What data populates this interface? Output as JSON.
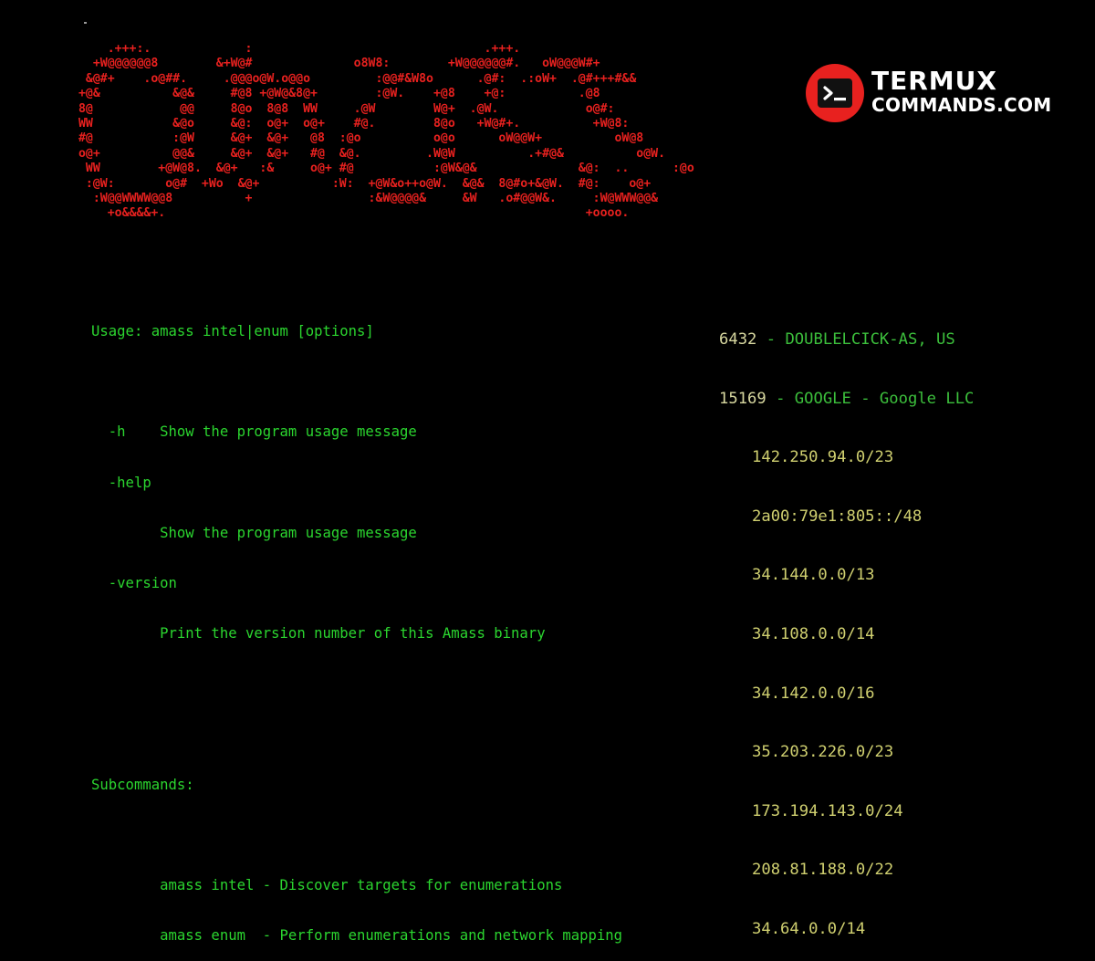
{
  "banner": {
    "ascii_art": "     .+++:.             :                                .+++.\n   +W@@@@@@8        &+W@#              o8W8:        +W@@@@@@#.   oW@@@W#+\n  &@#+    .o@##.     .@@@o@W.o@@o         :@@#&W8o      .@#:  .:oW+  .@#+++#&&\n +@&          &@&     #@8 +@W@&8@+        :@W.    +@8    +@:          .@8\n 8@            @@     8@o  8@8  WW     .@W        W@+  .@W.            o@#:\n WW           &@o     &@:  o@+  o@+    #@.        8@o   +W@#+.          +W@8:\n #@           :@W     &@+  &@+   @8  :@o          o@o      oW@@W+          oW@8\n o@+          @@&     &@+  &@+   #@  &@.         .W@W          .+#@&          o@W.\n  WW        +@W@8.  &@+   :&     o@+ #@           :@W&@&              &@:  ..      :@o\n  :@W:       o@#  +Wo  &@+          :W:  +@W&o++o@W.  &@&  8@#o+&@W.  #@:    o@+\n   :W@@WWWW@@8          +                :&W@@@@&     &W   .o#@@W&.     :W@WWW@@&\n     +o&&&&+.                                                          +oooo."
  },
  "brand": {
    "line1": "TERMUX",
    "line2": "COMMANDS.COM",
    "badge_glyph": "terminal-prompt-icon",
    "accent_color": "#e8211f"
  },
  "help": {
    "usage": "Usage: amass intel|enum [options]",
    "blank1": "",
    "opt_h": "  -h    Show the program usage message",
    "opt_help": "  -help",
    "opt_help_desc": "        Show the program usage message",
    "opt_version": "  -version",
    "opt_version_desc": "        Print the version number of this Amass binary",
    "blank2": "",
    "blank3": "",
    "subcommands": "Subcommands:",
    "blank4": "",
    "cmd_intel": "        amass intel - Discover targets for enumerations",
    "cmd_enum": "        amass enum  - Perform enumerations and network mapping",
    "text_color": "#2bd52f"
  },
  "asn": {
    "entries": [
      {
        "number": "6432",
        "name": " - DOUBLELCICK-AS, US"
      },
      {
        "number": "15169",
        "name": " - GOOGLE - Google LLC"
      }
    ],
    "cidrs": [
      "142.250.94.0/23",
      "2a00:79e1:805::/48",
      "34.144.0.0/13",
      "34.108.0.0/14",
      "34.142.0.0/16",
      "35.203.226.0/23",
      "173.194.143.0/24",
      "208.81.188.0/22",
      "34.64.0.0/14"
    ]
  }
}
